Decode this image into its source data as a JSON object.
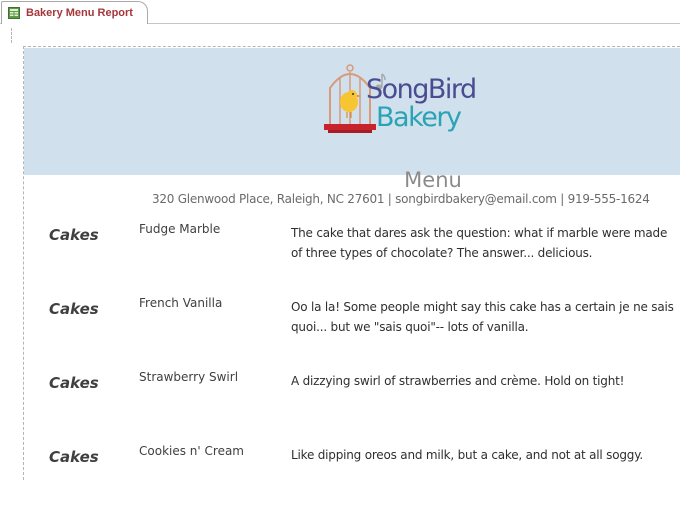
{
  "tab": {
    "label": "Bakery Menu Report",
    "icon": "report-icon"
  },
  "report": {
    "logo": {
      "line1": "SongBird",
      "line2": "Bakery",
      "colors": {
        "songbird": "#4b4b91",
        "bakery": "#2aa3b4",
        "bird": "#f7c531",
        "base": "#c8232c"
      }
    },
    "title": "Menu",
    "address": "320 Glenwood Place, Raleigh, NC 27601 | songbirdbakery@email.com  | 919-555-1624",
    "header_color": "#d0e0ec",
    "rows": [
      {
        "category": "Cakes",
        "item": "Fudge Marble",
        "description": "The cake that dares ask the question: what if marble were made of three types of chocolate? The answer... delicious."
      },
      {
        "category": "Cakes",
        "item": "French Vanilla",
        "description": "Oo la la! Some people might say this cake has a certain je ne sais quoi... but we \"sais quoi\"-- lots of vanilla."
      },
      {
        "category": "Cakes",
        "item": "Strawberry Swirl",
        "description": "A dizzying swirl of strawberries and crème. Hold on tight!"
      },
      {
        "category": "Cakes",
        "item": "Cookies n' Cream",
        "description": "Like dipping oreos and milk, but a cake, and not at all soggy."
      }
    ]
  }
}
